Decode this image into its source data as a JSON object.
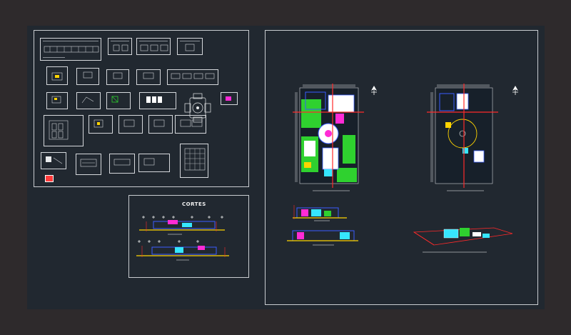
{
  "colors": {
    "background": "#2e2a2c",
    "model_space": "#212830",
    "frame": "#c9ccd0",
    "vegetation": "#2fd12f",
    "grid_axis": "#ff2a2a",
    "walls": "#3a5cff",
    "accent_magenta": "#ff2bd6",
    "accent_yellow": "#ffd400",
    "accent_cyan": "#36e6ff"
  },
  "cortes": {
    "title": "CORTES"
  },
  "compass_icons": [
    "north-arrow-icon",
    "north-arrow-icon"
  ]
}
